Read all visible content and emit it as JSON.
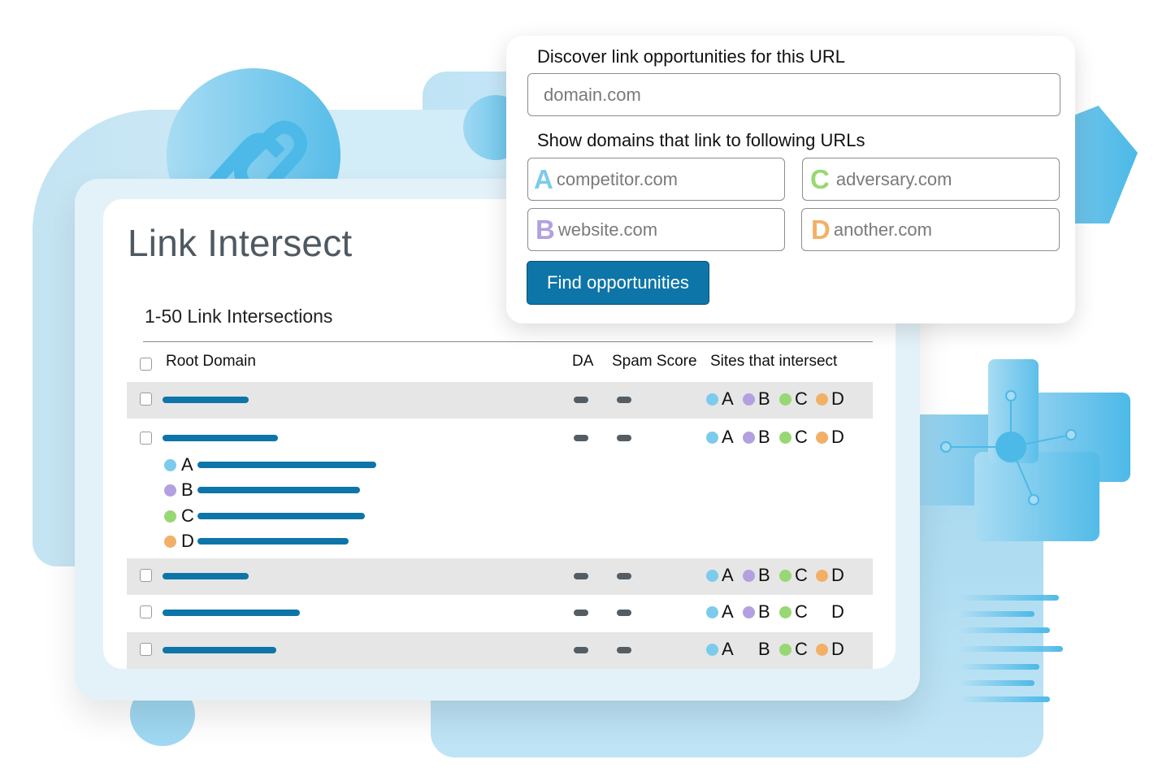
{
  "page": {
    "title": "Link Intersect",
    "section_title": "1-50 Link Intersections"
  },
  "table": {
    "columns": {
      "root_domain": "Root Domain",
      "da": "DA",
      "spam_score": "Spam Score",
      "sites": "Sites that intersect"
    },
    "rows": [
      {
        "shaded": true,
        "sites": [
          true,
          true,
          true,
          true
        ]
      },
      {
        "shaded": false,
        "sites": [
          true,
          true,
          true,
          true
        ],
        "expanded": true
      },
      {
        "shaded": true,
        "sites": [
          true,
          true,
          true,
          true
        ]
      },
      {
        "shaded": false,
        "sites": [
          true,
          true,
          true,
          false
        ]
      },
      {
        "shaded": true,
        "sites": [
          true,
          false,
          true,
          true
        ]
      }
    ],
    "expanded_sites": [
      "A",
      "B",
      "C",
      "D"
    ]
  },
  "sites": {
    "letters": [
      "A",
      "B",
      "C",
      "D"
    ],
    "colors": {
      "A": "#7ccbec",
      "B": "#b3a0e0",
      "C": "#97d874",
      "D": "#f2b067"
    }
  },
  "form": {
    "url_label": "Discover link opportunities for this URL",
    "url_placeholder": "domain.com",
    "compare_label": "Show domains that link to following URLs",
    "fields": {
      "A": {
        "letter": "A",
        "placeholder": "competitor.com"
      },
      "B": {
        "letter": "B",
        "placeholder": "website.com"
      },
      "C": {
        "letter": "C",
        "placeholder": "adversary.com"
      },
      "D": {
        "letter": "D",
        "placeholder": "another.com"
      }
    },
    "submit_label": "Find opportunities"
  },
  "colors": {
    "accent": "#0e75a8",
    "title_text": "#4f5961",
    "decor_blue": "#4cb9e8"
  },
  "icons": {
    "hero": "link-chain-icon",
    "network": "network-nodes-icon"
  }
}
